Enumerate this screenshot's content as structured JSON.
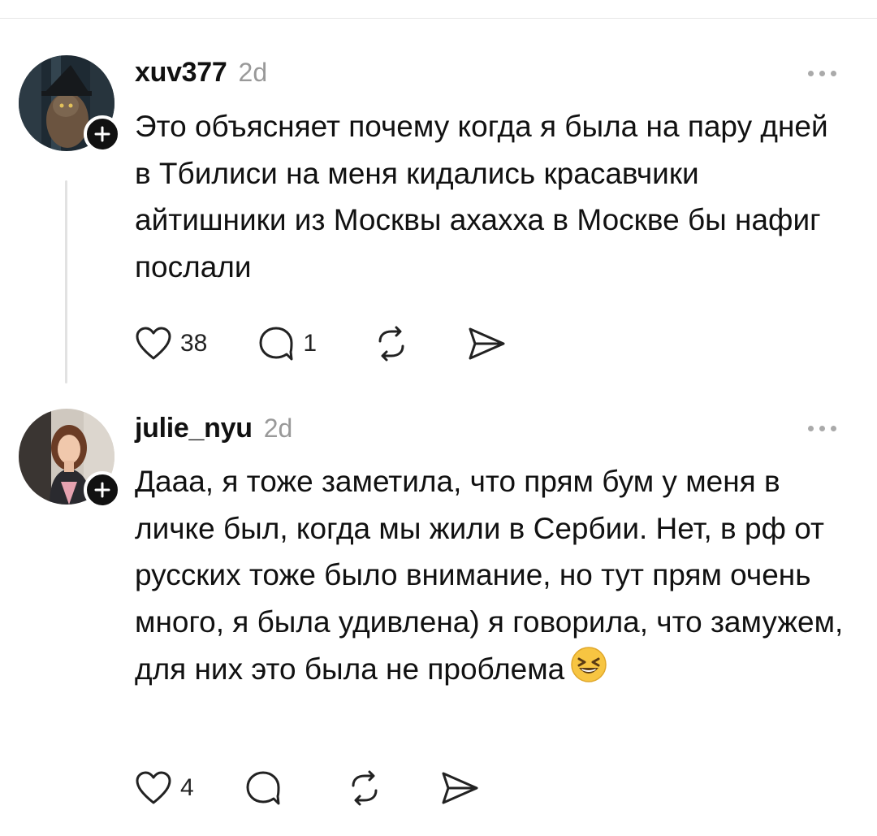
{
  "comments": [
    {
      "username": "xuv377",
      "time": "2d",
      "text": "Это объясняет почему когда я была на пару дней в Тбилиси на меня кидались красавчики айтишники из Москвы ахахха в Москве бы нафиг послали",
      "likes": "38",
      "replies": "1",
      "avatar_icon": "wizard-cat-avatar"
    },
    {
      "username": "julie_nyu",
      "time": "2d",
      "text": "Дааа, я тоже заметила, что прям бум у меня в личке был, когда мы жили в Сербии. Нет, в рф от русских тоже было внимание, но тут прям очень много, я была удивлена) я говорила, что замужем, для них это была не проблема",
      "emoji": "😆",
      "likes": "4",
      "replies": "",
      "avatar_icon": "woman-portrait-avatar"
    }
  ],
  "icons": {
    "like": "heart-icon",
    "reply": "comment-bubble-icon",
    "repost": "repost-icon",
    "share": "send-icon",
    "more": "more-dots-icon",
    "follow": "plus-icon"
  },
  "colors": {
    "text": "#111111",
    "muted": "#999999",
    "divider": "#e6e6e6"
  }
}
